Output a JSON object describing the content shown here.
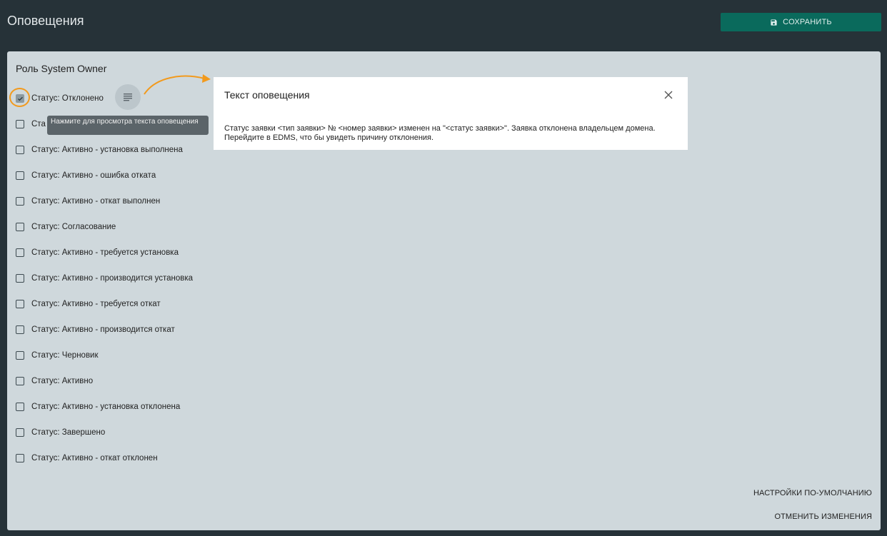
{
  "header": {
    "title": "Оповещения",
    "save_label": "СОХРАНИТЬ",
    "save_icon": "save-icon"
  },
  "panel": {
    "role_title": "Роль System Owner",
    "items": [
      {
        "label": "Статус: Отклонено",
        "checked": true
      },
      {
        "label": "Ста",
        "checked": false
      },
      {
        "label": "Статус: Активно - установка выполнена",
        "checked": false
      },
      {
        "label": "Статус: Активно - ошибка отката",
        "checked": false
      },
      {
        "label": "Статус: Активно - откат выполнен",
        "checked": false
      },
      {
        "label": "Статус: Согласование",
        "checked": false
      },
      {
        "label": "Статус: Активно - требуется установка",
        "checked": false
      },
      {
        "label": "Статус: Активно - производится установка",
        "checked": false
      },
      {
        "label": "Статус: Активно - требуется откат",
        "checked": false
      },
      {
        "label": "Статус: Активно - производится откат",
        "checked": false
      },
      {
        "label": "Статус: Черновик",
        "checked": false
      },
      {
        "label": "Статус: Активно",
        "checked": false
      },
      {
        "label": "Статус: Активно - установка отклонена",
        "checked": false
      },
      {
        "label": "Статус: Завершено",
        "checked": false
      },
      {
        "label": "Статус: Активно - откат отклонен",
        "checked": false
      }
    ],
    "tooltip": "Нажмите для просмотра текста оповещения",
    "defaults_label": "НАСТРОЙКИ ПО-УМОЛЧАНИЮ",
    "cancel_label": "ОТМЕНИТЬ ИЗМЕНЕНИЯ"
  },
  "dialog": {
    "title": "Текст оповещения",
    "body": "Статус заявки <тип заявки> № <номер заявки> изменен на \"<статус заявки>\". Заявка отклонена владельцем домена. Перейдите в EDMS, что бы увидеть причину отклонения."
  },
  "colors": {
    "background": "#263238",
    "panel": "#cfd8dc",
    "accent": "#0a6a5c",
    "highlight": "#f29a1d"
  }
}
